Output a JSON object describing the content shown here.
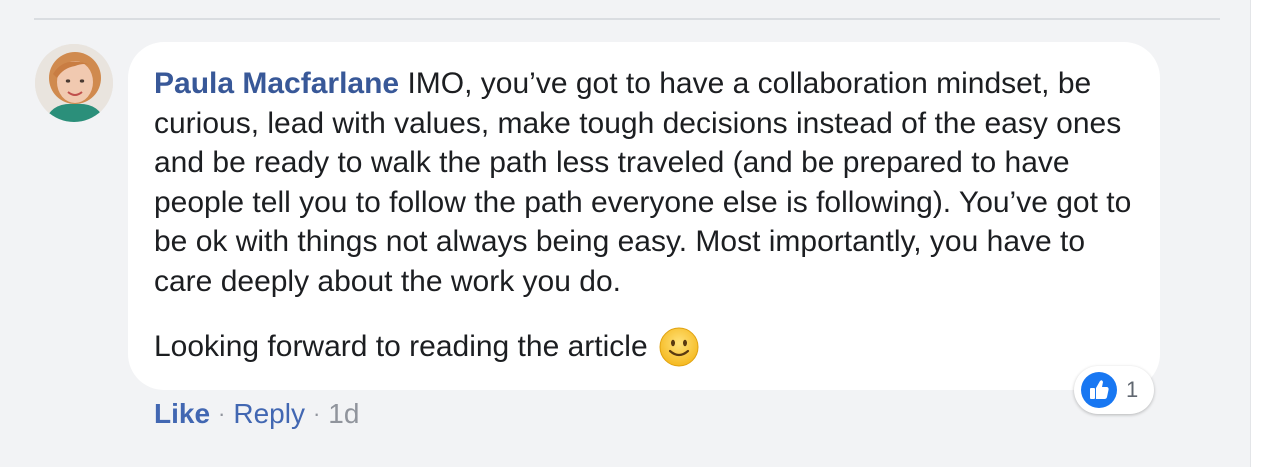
{
  "comment": {
    "author": "Paula Macfarlane",
    "text": "IMO, you’ve got to have a collaboration mindset, be curious, lead with values, make tough decisions instead of the easy ones and be ready to walk the path less traveled (and be prepared to have people tell you to follow the path everyone else is following). You’ve got to be ok with things not always being easy. Most importantly, you have to care deeply about the work you do.",
    "text_line2": "Looking forward to reading the article",
    "emoji": "smiley-icon"
  },
  "reactions": {
    "icon": "like-badge-icon",
    "count": "1"
  },
  "actions": {
    "like_label": "Like",
    "reply_label": "Reply",
    "separator": "·",
    "timestamp": "1d"
  },
  "colors": {
    "author": "#385898",
    "action_link": "#4267b2",
    "muted": "#90949c",
    "like_badge": "#1877f2",
    "bubble_bg": "#ffffff",
    "page_bg": "#f2f3f5"
  }
}
